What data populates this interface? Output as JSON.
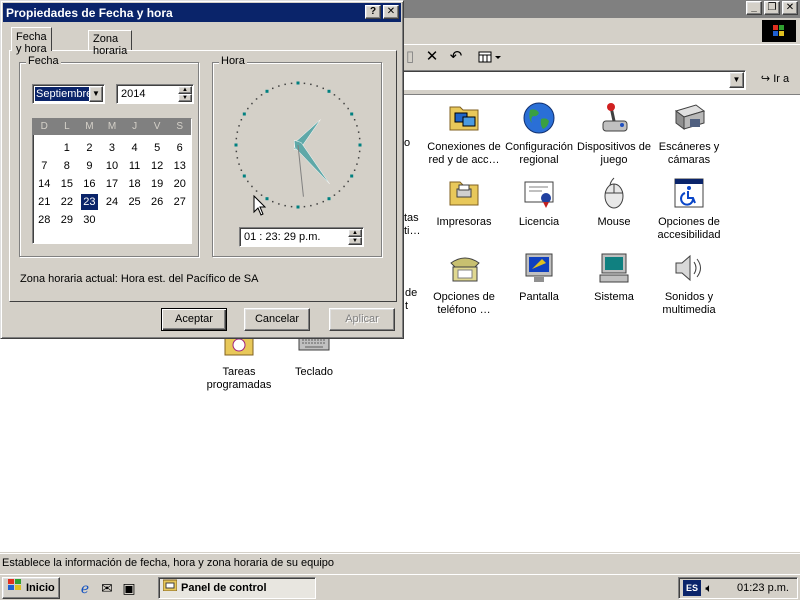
{
  "dialog": {
    "title": "Propiedades de Fecha y hora",
    "help_btn": "?",
    "close_btn": "✕",
    "tabs": [
      "Fecha y hora",
      "Zona horaria"
    ],
    "date_group": "Fecha",
    "time_group": "Hora",
    "month": "Septiembre",
    "year": "2014",
    "weekdays": [
      "D",
      "L",
      "M",
      "M",
      "J",
      "V",
      "S"
    ],
    "days": [
      "",
      "1",
      "2",
      "3",
      "4",
      "5",
      "6",
      "7",
      "8",
      "9",
      "10",
      "11",
      "12",
      "13",
      "14",
      "15",
      "16",
      "17",
      "18",
      "19",
      "20",
      "21",
      "22",
      "23",
      "24",
      "25",
      "26",
      "27",
      "28",
      "29",
      "30"
    ],
    "selected_day": "23",
    "time": "01 : 23: 29 p.m.",
    "clock": {
      "hour": 1,
      "minute": 23,
      "second": 29
    },
    "timezone_text": "Zona horaria actual:  Hora est. del Pacífico de SA",
    "buttons": {
      "ok": "Aceptar",
      "cancel": "Cancelar",
      "apply": "Aplicar"
    }
  },
  "cp_window": {
    "title_buttons": [
      "_",
      "❐",
      "✕"
    ],
    "go_label": "Ir a",
    "status": "Establece la información de fecha, hora y zona horaria de su equipo",
    "partial_labels": [
      "o",
      "tas",
      "ti…",
      "de",
      "t"
    ],
    "icons": [
      {
        "label": "Conexiones de red y de acc…",
        "icon": "network-connections-icon"
      },
      {
        "label": "Configuración regional",
        "icon": "globe-icon"
      },
      {
        "label": "Dispositivos de juego",
        "icon": "joystick-icon"
      },
      {
        "label": "Escáneres y cámaras",
        "icon": "scanner-icon"
      },
      {
        "label": "Impresoras",
        "icon": "printer-folder-icon"
      },
      {
        "label": "Licencia",
        "icon": "license-certificate-icon"
      },
      {
        "label": "Mouse",
        "icon": "mouse-icon"
      },
      {
        "label": "Opciones de accesibilidad",
        "icon": "accessibility-icon"
      },
      {
        "label": "Opciones de teléfono …",
        "icon": "telephone-icon"
      },
      {
        "label": "Pantalla",
        "icon": "display-icon"
      },
      {
        "label": "Sistema",
        "icon": "computer-icon"
      },
      {
        "label": "Sonidos y multimedia",
        "icon": "speaker-icon"
      },
      {
        "label": "Tareas programadas",
        "icon": "scheduled-tasks-icon"
      },
      {
        "label": "Teclado",
        "icon": "keyboard-icon"
      }
    ]
  },
  "taskbar": {
    "start": "Inicio",
    "task": "Panel de control",
    "lang": "ES",
    "clock": "01:23 p.m."
  }
}
